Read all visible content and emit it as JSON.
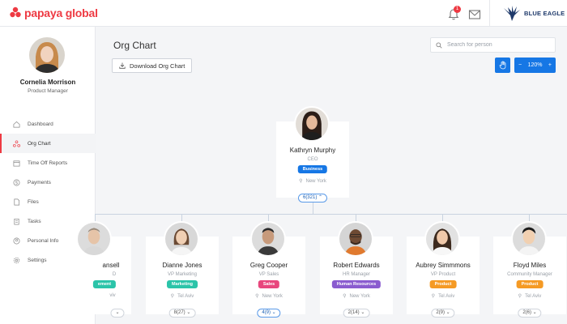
{
  "brand": {
    "logo_text": "papaya global",
    "company_name": "BLUE EAGLE",
    "accent": "#ee3a43",
    "primary": "#1677e5"
  },
  "header": {
    "notification_count": "1"
  },
  "user": {
    "name": "Cornelia Morrison",
    "role": "Product Manager"
  },
  "sidebar": {
    "items": [
      {
        "label": "Dashboard",
        "icon": "home-icon"
      },
      {
        "label": "Org Chart",
        "icon": "org-chart-icon",
        "active": true
      },
      {
        "label": "Time Off Reports",
        "icon": "calendar-icon"
      },
      {
        "label": "Payments",
        "icon": "dollar-icon"
      },
      {
        "label": "Files",
        "icon": "file-icon"
      },
      {
        "label": "Tasks",
        "icon": "clipboard-icon"
      },
      {
        "label": "Personal Information",
        "icon": "person-icon"
      },
      {
        "label": "Settings",
        "icon": "gear-icon"
      }
    ]
  },
  "main": {
    "title": "Org Chart",
    "download_label": "Download Org Chart",
    "search_placeholder": "Search for person",
    "zoom_label": "120%",
    "zoom_minus": "−",
    "zoom_plus": "+"
  },
  "root": {
    "name": "Kathryn Murphy",
    "role": "CEO",
    "dept": "Business",
    "dept_color": "#1677e5",
    "location": "New York",
    "count": "6(321)"
  },
  "employees": [
    {
      "name": "Ronald Ansell",
      "name_visible": "ansell",
      "role": "CMO",
      "role_visible": "D",
      "dept": "Management",
      "dept_visible": "ement",
      "dept_color": "#2bc4a9",
      "location": "Tel Aviv",
      "location_visible": "viv",
      "count": ""
    },
    {
      "name": "Dianne Jones",
      "role": "VP Marketing",
      "dept": "Marketing",
      "dept_color": "#2bc4a9",
      "location": "Tel Aviv",
      "count": "8(27)"
    },
    {
      "name": "Greg Cooper",
      "role": "VP Sales",
      "dept": "Sales",
      "dept_color": "#e8477d",
      "location": "New York",
      "count": "4(9)",
      "highlight": true
    },
    {
      "name": "Robert Edwards",
      "role": "HR Manager",
      "dept": "Human Resources",
      "dept_color": "#8a5ccf",
      "location": "New York",
      "count": "2(14)"
    },
    {
      "name": "Aubrey Simmmons",
      "role": "VP Product",
      "dept": "Product",
      "dept_color": "#f59a24",
      "location": "Tel Aviv",
      "count": "2(9)"
    },
    {
      "name": "Floyd Miles",
      "role": "Community Manager",
      "dept": "Product",
      "dept_color": "#f59a24",
      "location": "Tel Aviv",
      "count": "2(6)"
    }
  ]
}
